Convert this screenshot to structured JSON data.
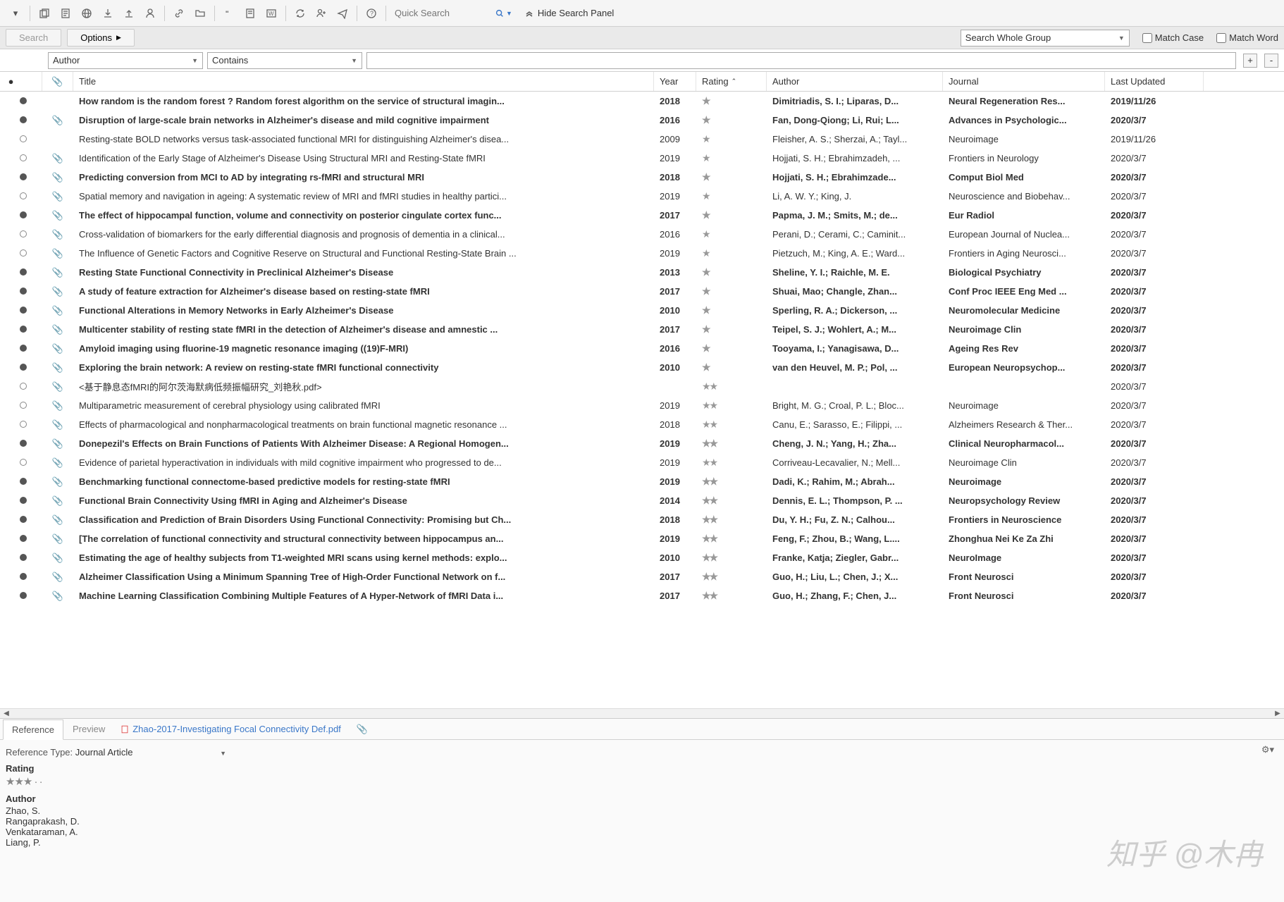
{
  "toolbar": {
    "quick_search_placeholder": "Quick Search",
    "hide_panel": "Hide Search Panel"
  },
  "searchbar": {
    "search_btn": "Search",
    "options_btn": "Options",
    "scope": "Search Whole Group",
    "match_case": "Match Case",
    "match_words": "Match Word"
  },
  "filter": {
    "field": "Author",
    "op": "Contains"
  },
  "columns": {
    "title": "Title",
    "year": "Year",
    "rating": "Rating",
    "author": "Author",
    "journal": "Journal",
    "updated": "Last Updated"
  },
  "records": [
    {
      "read": true,
      "att": false,
      "bold": true,
      "rating": 1,
      "title": "How random is the random forest ? Random forest algorithm on the service of structural imagin...",
      "year": "2018",
      "author": "Dimitriadis, S. I.; Liparas, D...",
      "journal": "Neural Regeneration Res...",
      "updated": "2019/11/26"
    },
    {
      "read": true,
      "att": true,
      "bold": true,
      "rating": 1,
      "title": "Disruption of large-scale brain networks in Alzheimer's disease and mild cognitive impairment",
      "year": "2016",
      "author": "Fan, Dong-Qiong; Li, Rui; L...",
      "journal": "Advances in Psychologic...",
      "updated": "2020/3/7"
    },
    {
      "read": false,
      "att": false,
      "bold": false,
      "rating": 1,
      "title": "Resting-state BOLD networks versus task-associated functional MRI for distinguishing Alzheimer's disea...",
      "year": "2009",
      "author": "Fleisher, A. S.; Sherzai, A.; Tayl...",
      "journal": "Neuroimage",
      "updated": "2019/11/26"
    },
    {
      "read": false,
      "att": true,
      "bold": false,
      "rating": 1,
      "title": "Identification of the Early Stage of Alzheimer's Disease Using Structural MRI and Resting-State fMRI",
      "year": "2019",
      "author": "Hojjati, S. H.; Ebrahimzadeh, ...",
      "journal": "Frontiers in Neurology",
      "updated": "2020/3/7"
    },
    {
      "read": true,
      "att": true,
      "bold": true,
      "rating": 1,
      "title": "Predicting conversion from MCI to AD by integrating rs-fMRI and structural MRI",
      "year": "2018",
      "author": "Hojjati, S. H.; Ebrahimzade...",
      "journal": "Comput Biol Med",
      "updated": "2020/3/7"
    },
    {
      "read": false,
      "att": true,
      "bold": false,
      "rating": 1,
      "title": "Spatial memory and navigation in ageing: A systematic review of MRI and fMRI studies in healthy partici...",
      "year": "2019",
      "author": "Li, A. W. Y.; King, J.",
      "journal": "Neuroscience and Biobehav...",
      "updated": "2020/3/7"
    },
    {
      "read": true,
      "att": true,
      "bold": true,
      "rating": 1,
      "title": "The effect of hippocampal function, volume and connectivity on posterior cingulate cortex func...",
      "year": "2017",
      "author": "Papma, J. M.; Smits, M.; de...",
      "journal": "Eur Radiol",
      "updated": "2020/3/7"
    },
    {
      "read": false,
      "att": true,
      "bold": false,
      "rating": 1,
      "title": "Cross-validation of biomarkers for the early differential diagnosis and prognosis of dementia in a clinical...",
      "year": "2016",
      "author": "Perani, D.; Cerami, C.; Caminit...",
      "journal": "European Journal of Nuclea...",
      "updated": "2020/3/7"
    },
    {
      "read": false,
      "att": true,
      "bold": false,
      "rating": 1,
      "title": "The Influence of Genetic Factors and Cognitive Reserve on Structural and Functional Resting-State Brain ...",
      "year": "2019",
      "author": "Pietzuch, M.; King, A. E.; Ward...",
      "journal": "Frontiers in Aging Neurosci...",
      "updated": "2020/3/7"
    },
    {
      "read": true,
      "att": true,
      "bold": true,
      "rating": 1,
      "title": "Resting State Functional Connectivity in Preclinical Alzheimer's Disease",
      "year": "2013",
      "author": "Sheline, Y. I.; Raichle, M. E.",
      "journal": "Biological Psychiatry",
      "updated": "2020/3/7"
    },
    {
      "read": true,
      "att": true,
      "bold": true,
      "rating": 1,
      "title": "A study of feature extraction for Alzheimer's disease based on resting-state fMRI",
      "year": "2017",
      "author": "Shuai, Mao; Changle, Zhan...",
      "journal": "Conf Proc IEEE Eng Med ...",
      "updated": "2020/3/7"
    },
    {
      "read": true,
      "att": true,
      "bold": true,
      "rating": 1,
      "title": "Functional Alterations in Memory Networks in Early Alzheimer's Disease",
      "year": "2010",
      "author": "Sperling, R. A.; Dickerson, ...",
      "journal": "Neuromolecular Medicine",
      "updated": "2020/3/7"
    },
    {
      "read": true,
      "att": true,
      "bold": true,
      "rating": 1,
      "title": "Multicenter stability of resting state fMRI in the detection of Alzheimer's disease and amnestic ...",
      "year": "2017",
      "author": "Teipel, S. J.; Wohlert, A.; M...",
      "journal": "Neuroimage Clin",
      "updated": "2020/3/7"
    },
    {
      "read": true,
      "att": true,
      "bold": true,
      "rating": 1,
      "title": "Amyloid imaging using fluorine-19 magnetic resonance imaging ((19)F-MRI)",
      "year": "2016",
      "author": "Tooyama, I.; Yanagisawa, D...",
      "journal": "Ageing Res Rev",
      "updated": "2020/3/7"
    },
    {
      "read": true,
      "att": true,
      "bold": true,
      "rating": 1,
      "title": "Exploring the brain network: A review on resting-state fMRI functional connectivity",
      "year": "2010",
      "author": "van den Heuvel, M. P.; Pol, ...",
      "journal": "European Neuropsychop...",
      "updated": "2020/3/7"
    },
    {
      "read": false,
      "att": true,
      "bold": false,
      "rating": 2,
      "title": "<基于静息态fMRI的阿尔茨海默病低频振幅研究_刘艳秋.pdf>",
      "year": "",
      "author": "",
      "journal": "",
      "updated": "2020/3/7"
    },
    {
      "read": false,
      "att": true,
      "bold": false,
      "rating": 2,
      "title": "Multiparametric measurement of cerebral physiology using calibrated fMRI",
      "year": "2019",
      "author": "Bright, M. G.; Croal, P. L.; Bloc...",
      "journal": "Neuroimage",
      "updated": "2020/3/7"
    },
    {
      "read": false,
      "att": true,
      "bold": false,
      "rating": 2,
      "title": "Effects of pharmacological and nonpharmacological treatments on brain functional magnetic resonance ...",
      "year": "2018",
      "author": "Canu, E.; Sarasso, E.; Filippi, ...",
      "journal": "Alzheimers Research & Ther...",
      "updated": "2020/3/7"
    },
    {
      "read": true,
      "att": true,
      "bold": true,
      "rating": 2,
      "title": "Donepezil's Effects on Brain Functions of Patients With Alzheimer Disease: A Regional Homogen...",
      "year": "2019",
      "author": "Cheng, J. N.; Yang, H.; Zha...",
      "journal": "Clinical Neuropharmacol...",
      "updated": "2020/3/7"
    },
    {
      "read": false,
      "att": true,
      "bold": false,
      "rating": 2,
      "title": "Evidence of parietal hyperactivation in individuals with mild cognitive impairment who progressed to de...",
      "year": "2019",
      "author": "Corriveau-Lecavalier, N.; Mell...",
      "journal": "Neuroimage Clin",
      "updated": "2020/3/7"
    },
    {
      "read": true,
      "att": true,
      "bold": true,
      "rating": 2,
      "title": "Benchmarking functional connectome-based predictive models for resting-state fMRI",
      "year": "2019",
      "author": "Dadi, K.; Rahim, M.; Abrah...",
      "journal": "Neuroimage",
      "updated": "2020/3/7"
    },
    {
      "read": true,
      "att": true,
      "bold": true,
      "rating": 2,
      "title": "Functional Brain Connectivity Using fMRI in Aging and Alzheimer's Disease",
      "year": "2014",
      "author": "Dennis, E. L.; Thompson, P. ...",
      "journal": "Neuropsychology Review",
      "updated": "2020/3/7"
    },
    {
      "read": true,
      "att": true,
      "bold": true,
      "rating": 2,
      "title": "Classification and Prediction of Brain Disorders Using Functional Connectivity: Promising but Ch...",
      "year": "2018",
      "author": "Du, Y. H.; Fu, Z. N.; Calhou...",
      "journal": "Frontiers in Neuroscience",
      "updated": "2020/3/7"
    },
    {
      "read": true,
      "att": true,
      "bold": true,
      "rating": 2,
      "title": "[The correlation of functional connectivity and structural connectivity between hippocampus an...",
      "year": "2019",
      "author": "Feng, F.; Zhou, B.; Wang, L....",
      "journal": "Zhonghua Nei Ke Za Zhi",
      "updated": "2020/3/7"
    },
    {
      "read": true,
      "att": true,
      "bold": true,
      "rating": 2,
      "title": "Estimating the age of healthy subjects from T1-weighted MRI scans using kernel methods: explo...",
      "year": "2010",
      "author": "Franke, Katja; Ziegler, Gabr...",
      "journal": "NeuroImage",
      "updated": "2020/3/7"
    },
    {
      "read": true,
      "att": true,
      "bold": true,
      "rating": 2,
      "title": "Alzheimer Classification Using a Minimum Spanning Tree of High-Order Functional Network on f...",
      "year": "2017",
      "author": "Guo, H.; Liu, L.; Chen, J.; X...",
      "journal": "Front Neurosci",
      "updated": "2020/3/7"
    },
    {
      "read": true,
      "att": true,
      "bold": true,
      "rating": 2,
      "title": "Machine Learning Classification Combining Multiple Features of A Hyper-Network of fMRI Data i...",
      "year": "2017",
      "author": "Guo, H.; Zhang, F.; Chen, J...",
      "journal": "Front Neurosci",
      "updated": "2020/3/7"
    }
  ],
  "details": {
    "tabs": [
      "Reference",
      "Preview"
    ],
    "pdf_name": "Zhao-2017-Investigating Focal Connectivity Def.pdf",
    "ref_type_label": "Reference Type:",
    "ref_type_value": "Journal Article",
    "rating_label": "Rating",
    "rating_display": "★★★ ·  ·",
    "author_label": "Author",
    "authors": [
      "Zhao, S.",
      "Rangaprakash, D.",
      "Venkataraman, A.",
      "Liang, P."
    ]
  },
  "watermark": "知乎 @木冉"
}
